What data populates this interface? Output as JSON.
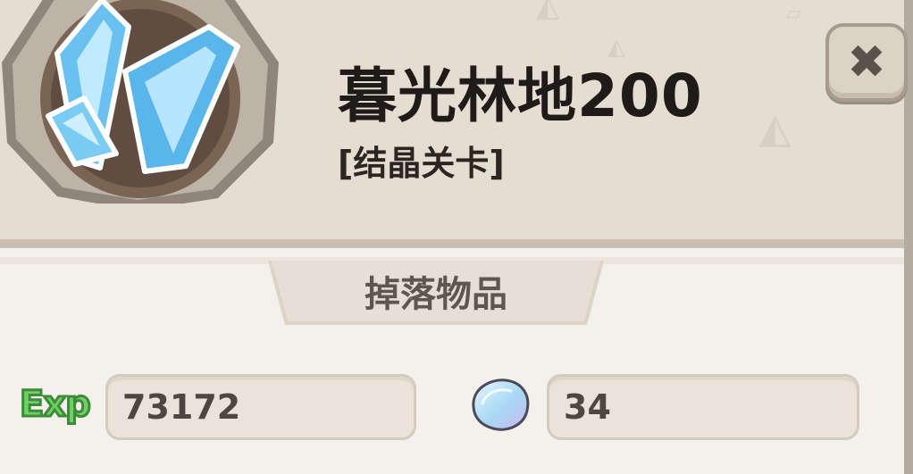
{
  "level": {
    "title": "暮光林地200",
    "subtitle": "[结晶关卡]",
    "icon": "crystal-icon"
  },
  "close_button": {
    "icon": "close-icon",
    "label": "✖"
  },
  "drops": {
    "tab_label": "掉落物品",
    "exp": {
      "label": "Exp",
      "value": "73172"
    },
    "shell": {
      "icon": "shell-icon",
      "value": "34"
    }
  },
  "colors": {
    "header_bg": "#e4ddd2",
    "panel_bg": "#f4f1ec",
    "exp_green": "#6fd165",
    "crystal_blue": "#8fd6f7"
  }
}
